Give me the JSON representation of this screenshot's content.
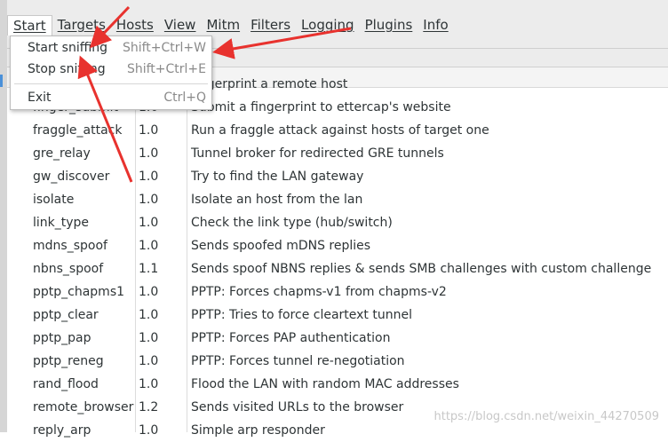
{
  "menubar": {
    "items": [
      {
        "label": "Start"
      },
      {
        "label": "Targets"
      },
      {
        "label": "Hosts"
      },
      {
        "label": "View"
      },
      {
        "label": "Mitm"
      },
      {
        "label": "Filters"
      },
      {
        "label": "Logging"
      },
      {
        "label": "Plugins"
      },
      {
        "label": "Info"
      }
    ]
  },
  "dropdown": {
    "items": [
      {
        "label": "Start sniffing",
        "accel": "Shift+Ctrl+W"
      },
      {
        "label": "Stop sniffing",
        "accel": "Shift+Ctrl+E"
      },
      {
        "label": "Exit",
        "accel": "Ctrl+Q"
      }
    ]
  },
  "plugins": {
    "partial_top": "fingerprint a remote host",
    "rows": [
      {
        "name": "finger_submit",
        "version": "1.0",
        "desc": "Submit a fingerprint to ettercap's website"
      },
      {
        "name": "fraggle_attack",
        "version": "1.0",
        "desc": "Run a fraggle attack against hosts of target one"
      },
      {
        "name": "gre_relay",
        "version": "1.0",
        "desc": "Tunnel broker for redirected GRE tunnels"
      },
      {
        "name": "gw_discover",
        "version": "1.0",
        "desc": "Try to find the LAN gateway"
      },
      {
        "name": "isolate",
        "version": "1.0",
        "desc": "Isolate an host from the lan"
      },
      {
        "name": "link_type",
        "version": "1.0",
        "desc": "Check the link type (hub/switch)"
      },
      {
        "name": "mdns_spoof",
        "version": "1.0",
        "desc": "Sends spoofed mDNS replies"
      },
      {
        "name": "nbns_spoof",
        "version": "1.1",
        "desc": "Sends spoof NBNS replies & sends SMB challenges with custom challenge"
      },
      {
        "name": "pptp_chapms1",
        "version": "1.0",
        "desc": "PPTP: Forces chapms-v1 from chapms-v2"
      },
      {
        "name": "pptp_clear",
        "version": "1.0",
        "desc": "PPTP: Tries to force cleartext tunnel"
      },
      {
        "name": "pptp_pap",
        "version": "1.0",
        "desc": "PPTP: Forces PAP authentication"
      },
      {
        "name": "pptp_reneg",
        "version": "1.0",
        "desc": "PPTP: Forces tunnel re-negotiation"
      },
      {
        "name": "rand_flood",
        "version": "1.0",
        "desc": "Flood the LAN with random MAC addresses"
      },
      {
        "name": "remote_browser",
        "version": "1.2",
        "desc": "Sends visited URLs to the browser"
      },
      {
        "name": "reply_arp",
        "version": "1.0",
        "desc": "Simple arp responder"
      }
    ]
  },
  "watermark": "https://blog.csdn.net/weixin_44270509",
  "colors": {
    "arrow": "#e8322e",
    "menubar": "#ececec"
  }
}
